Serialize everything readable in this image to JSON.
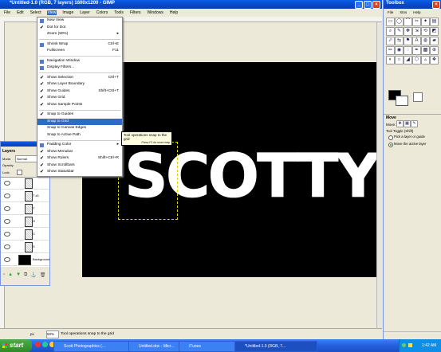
{
  "window": {
    "title": "*Untitled-1.0 (RGB, 7 layers) 1600x1200 - GIMP",
    "menu": [
      "File",
      "Edit",
      "Select",
      "View",
      "Image",
      "Layer",
      "Colors",
      "Tools",
      "Filters",
      "Windows",
      "Help"
    ],
    "active_menu": "View"
  },
  "view_menu": {
    "items": [
      {
        "label": "New View",
        "shortcut": "",
        "checked": false,
        "icon": "view-icon"
      },
      {
        "label": "Dot for Dot",
        "shortcut": "",
        "checked": true
      },
      {
        "label": "Zoom (50%)",
        "shortcut": "",
        "submenu": true
      },
      {
        "sep": true
      },
      {
        "label": "Shrink Wrap",
        "shortcut": "Ctrl+E",
        "icon": "shrink-icon"
      },
      {
        "label": "Fullscreen",
        "shortcut": "F11"
      },
      {
        "sep": true
      },
      {
        "label": "Navigation Window",
        "shortcut": "",
        "icon": "nav-icon"
      },
      {
        "label": "Display Filters...",
        "shortcut": "",
        "icon": "filter-icon"
      },
      {
        "sep": true
      },
      {
        "label": "Show Selection",
        "shortcut": "Ctrl+T",
        "checked": true
      },
      {
        "label": "Show Layer Boundary",
        "shortcut": "",
        "checked": true
      },
      {
        "label": "Show Guides",
        "shortcut": "Shift+Ctrl+T",
        "checked": true
      },
      {
        "label": "Show Grid",
        "shortcut": "",
        "checked": true
      },
      {
        "label": "Show Sample Points",
        "shortcut": "",
        "checked": true
      },
      {
        "sep": true
      },
      {
        "label": "Snap to Guides",
        "shortcut": "",
        "checked": true
      },
      {
        "label": "Snap to Grid",
        "shortcut": "",
        "checked": false,
        "highlight": true
      },
      {
        "label": "Snap to Canvas Edges",
        "shortcut": ""
      },
      {
        "label": "Snap to Active Path",
        "shortcut": ""
      },
      {
        "sep": true
      },
      {
        "label": "Padding Color",
        "shortcut": "",
        "submenu": true,
        "icon": "padding-icon"
      },
      {
        "label": "Show Menubar",
        "shortcut": "",
        "checked": true
      },
      {
        "label": "Show Rulers",
        "shortcut": "Shift+Ctrl+R",
        "checked": true
      },
      {
        "label": "Show Scrollbars",
        "shortcut": "",
        "checked": true
      },
      {
        "label": "Show Statusbar",
        "shortcut": "",
        "checked": true
      }
    ]
  },
  "tooltip": {
    "line1": "Tool operations snap to the grid",
    "line2": "Press F1 for more help"
  },
  "layers": {
    "title": "Layers",
    "mode_label": "Mode:",
    "mode_value": "Normal",
    "opacity_label": "Opacity:",
    "lock_label": "Lock:",
    "rows": [
      {
        "name": ""
      },
      {
        "name": "T #1"
      },
      {
        "name": "T"
      },
      {
        "name": "O"
      },
      {
        "name": "C"
      },
      {
        "name": "S"
      },
      {
        "name": "Background"
      }
    ]
  },
  "canvas": {
    "text": "SCOTTY"
  },
  "status": {
    "unit": "px",
    "zoom": "50%",
    "message": "Tool operations snap to the grid"
  },
  "toolbox": {
    "title": "Toolbox",
    "menu": [
      "File",
      "Xtns",
      "Help"
    ],
    "move_panel": {
      "title": "Move",
      "move_label": "Move:",
      "toggle_label": "Tool Toggle (Shift)",
      "opt1": "Pick a layer or guide",
      "opt2": "Move the active layer"
    }
  },
  "taskbar": {
    "start": "start",
    "tasks": [
      "Scott Photographics (...",
      "Untitled.doc - Micr...",
      "iTunes",
      "*Untitled-1.0 (RGB, 7..."
    ],
    "clock": "1:42 AM"
  }
}
